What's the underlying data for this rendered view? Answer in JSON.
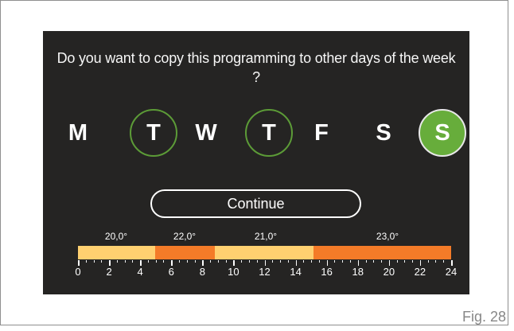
{
  "prompt": {
    "line1": "Do you want to copy this programming to other days of the week",
    "line2": "?"
  },
  "days": [
    {
      "label": "M",
      "state": "normal"
    },
    {
      "label": "T",
      "state": "selected"
    },
    {
      "label": "W",
      "state": "normal"
    },
    {
      "label": "T",
      "state": "selected"
    },
    {
      "label": "F",
      "state": "normal"
    },
    {
      "label": "S",
      "state": "normal"
    },
    {
      "label": "S",
      "state": "current"
    }
  ],
  "continue_label": "Continue",
  "schedule": {
    "temperatures": [
      "20,0°",
      "22,0°",
      "21,0°",
      "23,0°"
    ],
    "segments": [
      {
        "start": 0,
        "end": 5,
        "temperature": "20,0°",
        "color": "#ffd070"
      },
      {
        "start": 5,
        "end": 9,
        "temperature": "22,0°",
        "color": "#f47b28"
      },
      {
        "start": 9,
        "end": 15,
        "temperature": "21,0°",
        "color": "#ffd070"
      },
      {
        "start": 15,
        "end": 24,
        "temperature": "23,0°",
        "color": "#f47b28"
      }
    ],
    "hour_labels": [
      "0",
      "2",
      "4",
      "6",
      "8",
      "10",
      "12",
      "14",
      "16",
      "18",
      "20",
      "22",
      "24"
    ]
  },
  "colors": {
    "screen_background": "#252423",
    "selected_ring": "#5c9b37",
    "current_day": "#67ad3b",
    "light_segment": "#ffd070",
    "dark_segment": "#f47b28",
    "caption": "#878787"
  },
  "figure_caption": "Fig. 28"
}
